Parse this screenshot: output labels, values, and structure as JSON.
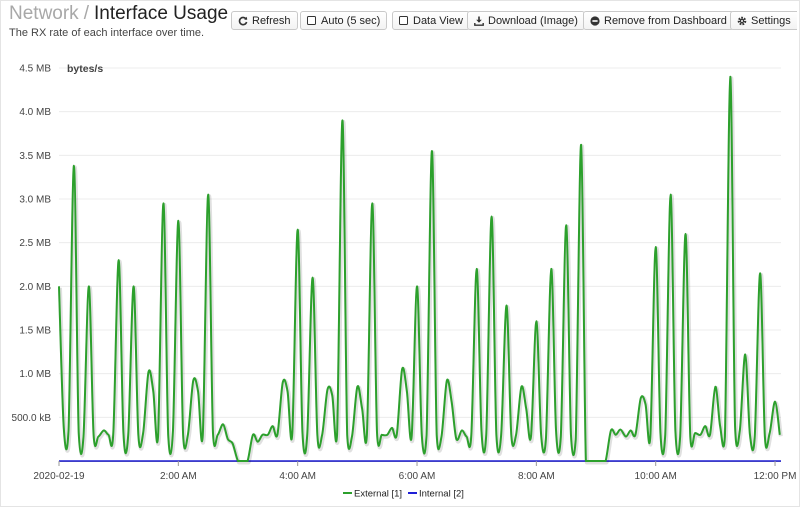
{
  "header": {
    "breadcrumb": "Network",
    "separator": "/",
    "page_title": "Interface Usage",
    "subtitle": "The RX rate of each interface over time."
  },
  "toolbar": {
    "refresh": {
      "label": "Refresh",
      "icon": "refresh-icon"
    },
    "auto": {
      "label": "Auto (5 sec)",
      "icon": "checkbox-icon"
    },
    "data_view": {
      "label": "Data View",
      "icon": "checkbox-icon"
    },
    "download": {
      "label": "Download (Image)",
      "icon": "download-icon"
    },
    "remove": {
      "label": "Remove from Dashboard",
      "icon": "minus-circle-icon"
    },
    "settings": {
      "label": "Settings",
      "icon": "gear-icon"
    }
  },
  "colors": {
    "external": "#2ca02c",
    "internal": "#1f1fd6"
  },
  "chart_data": {
    "type": "line",
    "ylabel": "bytes/s",
    "y_ticks": [
      {
        "value": 0.5,
        "label": "500.0 kB"
      },
      {
        "value": 1.0,
        "label": "1.0 MB"
      },
      {
        "value": 1.5,
        "label": "1.5 MB"
      },
      {
        "value": 2.0,
        "label": "2.0 MB"
      },
      {
        "value": 2.5,
        "label": "2.5 MB"
      },
      {
        "value": 3.0,
        "label": "3.0 MB"
      },
      {
        "value": 3.5,
        "label": "3.5 MB"
      },
      {
        "value": 4.0,
        "label": "4.0 MB"
      },
      {
        "value": 4.5,
        "label": "4.5 MB"
      }
    ],
    "ylim": [
      0,
      4.5
    ],
    "y_unit": "MB",
    "x_ticks": [
      {
        "value": 0,
        "label": "2020-02-19"
      },
      {
        "value": 2,
        "label": "2:00 AM"
      },
      {
        "value": 4,
        "label": "4:00 AM"
      },
      {
        "value": 6,
        "label": "6:00 AM"
      },
      {
        "value": 8,
        "label": "8:00 AM"
      },
      {
        "value": 10,
        "label": "10:00 AM"
      },
      {
        "value": 12,
        "label": "12:00 PM"
      }
    ],
    "xlim": [
      0,
      12.1
    ],
    "x_unit": "hours",
    "grid": "horizontal",
    "legend_position": "bottom",
    "series": [
      {
        "name": "External [1]",
        "color": "#2ca02c",
        "points": [
          [
            0.0,
            2.0
          ],
          [
            0.08,
            0.38
          ],
          [
            0.16,
            0.36
          ],
          [
            0.25,
            3.38
          ],
          [
            0.33,
            0.33
          ],
          [
            0.41,
            0.28
          ],
          [
            0.5,
            2.0
          ],
          [
            0.58,
            0.3
          ],
          [
            0.66,
            0.28
          ],
          [
            0.75,
            0.35
          ],
          [
            0.83,
            0.3
          ],
          [
            0.91,
            0.32
          ],
          [
            1.0,
            2.3
          ],
          [
            1.08,
            0.32
          ],
          [
            1.16,
            0.3
          ],
          [
            1.25,
            2.0
          ],
          [
            1.33,
            0.3
          ],
          [
            1.41,
            0.32
          ],
          [
            1.5,
            1.02
          ],
          [
            1.58,
            0.8
          ],
          [
            1.66,
            0.28
          ],
          [
            1.75,
            2.95
          ],
          [
            1.83,
            0.3
          ],
          [
            1.91,
            0.35
          ],
          [
            2.0,
            2.75
          ],
          [
            2.08,
            0.3
          ],
          [
            2.16,
            0.3
          ],
          [
            2.25,
            0.92
          ],
          [
            2.33,
            0.8
          ],
          [
            2.41,
            0.3
          ],
          [
            2.5,
            3.05
          ],
          [
            2.58,
            0.33
          ],
          [
            2.66,
            0.3
          ],
          [
            2.75,
            0.42
          ],
          [
            2.83,
            0.25
          ],
          [
            2.91,
            0.2
          ],
          [
            3.0,
            0.0
          ],
          [
            3.08,
            0.0
          ],
          [
            3.16,
            0.0
          ],
          [
            3.25,
            0.3
          ],
          [
            3.33,
            0.22
          ],
          [
            3.41,
            0.3
          ],
          [
            3.5,
            0.3
          ],
          [
            3.58,
            0.4
          ],
          [
            3.66,
            0.3
          ],
          [
            3.75,
            0.9
          ],
          [
            3.83,
            0.8
          ],
          [
            3.91,
            0.32
          ],
          [
            4.0,
            2.65
          ],
          [
            4.08,
            0.33
          ],
          [
            4.16,
            0.3
          ],
          [
            4.25,
            2.1
          ],
          [
            4.33,
            0.3
          ],
          [
            4.41,
            0.3
          ],
          [
            4.5,
            0.82
          ],
          [
            4.58,
            0.75
          ],
          [
            4.66,
            0.3
          ],
          [
            4.75,
            3.9
          ],
          [
            4.83,
            0.3
          ],
          [
            4.91,
            0.28
          ],
          [
            5.0,
            0.85
          ],
          [
            5.08,
            0.6
          ],
          [
            5.16,
            0.3
          ],
          [
            5.25,
            2.95
          ],
          [
            5.33,
            0.32
          ],
          [
            5.41,
            0.3
          ],
          [
            5.5,
            0.3
          ],
          [
            5.58,
            0.38
          ],
          [
            5.66,
            0.3
          ],
          [
            5.75,
            1.05
          ],
          [
            5.83,
            0.8
          ],
          [
            5.91,
            0.28
          ],
          [
            6.0,
            2.0
          ],
          [
            6.08,
            0.3
          ],
          [
            6.16,
            0.3
          ],
          [
            6.25,
            3.55
          ],
          [
            6.33,
            0.3
          ],
          [
            6.41,
            0.28
          ],
          [
            6.5,
            0.92
          ],
          [
            6.58,
            0.68
          ],
          [
            6.66,
            0.25
          ],
          [
            6.75,
            0.35
          ],
          [
            6.83,
            0.28
          ],
          [
            6.91,
            0.3
          ],
          [
            7.0,
            2.2
          ],
          [
            7.08,
            0.35
          ],
          [
            7.16,
            0.3
          ],
          [
            7.25,
            2.8
          ],
          [
            7.33,
            0.3
          ],
          [
            7.41,
            0.3
          ],
          [
            7.5,
            1.78
          ],
          [
            7.58,
            0.3
          ],
          [
            7.66,
            0.3
          ],
          [
            7.75,
            0.85
          ],
          [
            7.83,
            0.6
          ],
          [
            7.91,
            0.28
          ],
          [
            8.0,
            1.6
          ],
          [
            8.08,
            0.3
          ],
          [
            8.16,
            0.25
          ],
          [
            8.25,
            2.2
          ],
          [
            8.33,
            0.35
          ],
          [
            8.41,
            0.28
          ],
          [
            8.5,
            2.7
          ],
          [
            8.58,
            0.3
          ],
          [
            8.66,
            0.25
          ],
          [
            8.75,
            3.62
          ],
          [
            8.83,
            0.0
          ],
          [
            8.91,
            0.0
          ],
          [
            9.0,
            0.0
          ],
          [
            9.08,
            0.0
          ],
          [
            9.16,
            0.0
          ],
          [
            9.25,
            0.35
          ],
          [
            9.33,
            0.3
          ],
          [
            9.41,
            0.36
          ],
          [
            9.5,
            0.28
          ],
          [
            9.58,
            0.35
          ],
          [
            9.66,
            0.3
          ],
          [
            9.75,
            0.72
          ],
          [
            9.83,
            0.65
          ],
          [
            9.91,
            0.28
          ],
          [
            10.0,
            2.45
          ],
          [
            10.08,
            0.32
          ],
          [
            10.16,
            0.3
          ],
          [
            10.25,
            3.05
          ],
          [
            10.33,
            0.35
          ],
          [
            10.41,
            0.28
          ],
          [
            10.5,
            2.6
          ],
          [
            10.58,
            0.28
          ],
          [
            10.66,
            0.32
          ],
          [
            10.75,
            0.3
          ],
          [
            10.83,
            0.4
          ],
          [
            10.91,
            0.3
          ],
          [
            11.0,
            0.85
          ],
          [
            11.08,
            0.4
          ],
          [
            11.16,
            0.28
          ],
          [
            11.25,
            4.4
          ],
          [
            11.33,
            0.4
          ],
          [
            11.41,
            0.35
          ],
          [
            11.5,
            1.22
          ],
          [
            11.58,
            0.3
          ],
          [
            11.66,
            0.28
          ],
          [
            11.75,
            2.15
          ],
          [
            11.83,
            0.28
          ],
          [
            11.91,
            0.32
          ],
          [
            12.0,
            0.68
          ],
          [
            12.08,
            0.3
          ]
        ]
      },
      {
        "name": "Internal [2]",
        "color": "#1f1fd6",
        "points": [
          [
            0.0,
            0.0
          ],
          [
            12.1,
            0.0
          ]
        ]
      }
    ]
  }
}
